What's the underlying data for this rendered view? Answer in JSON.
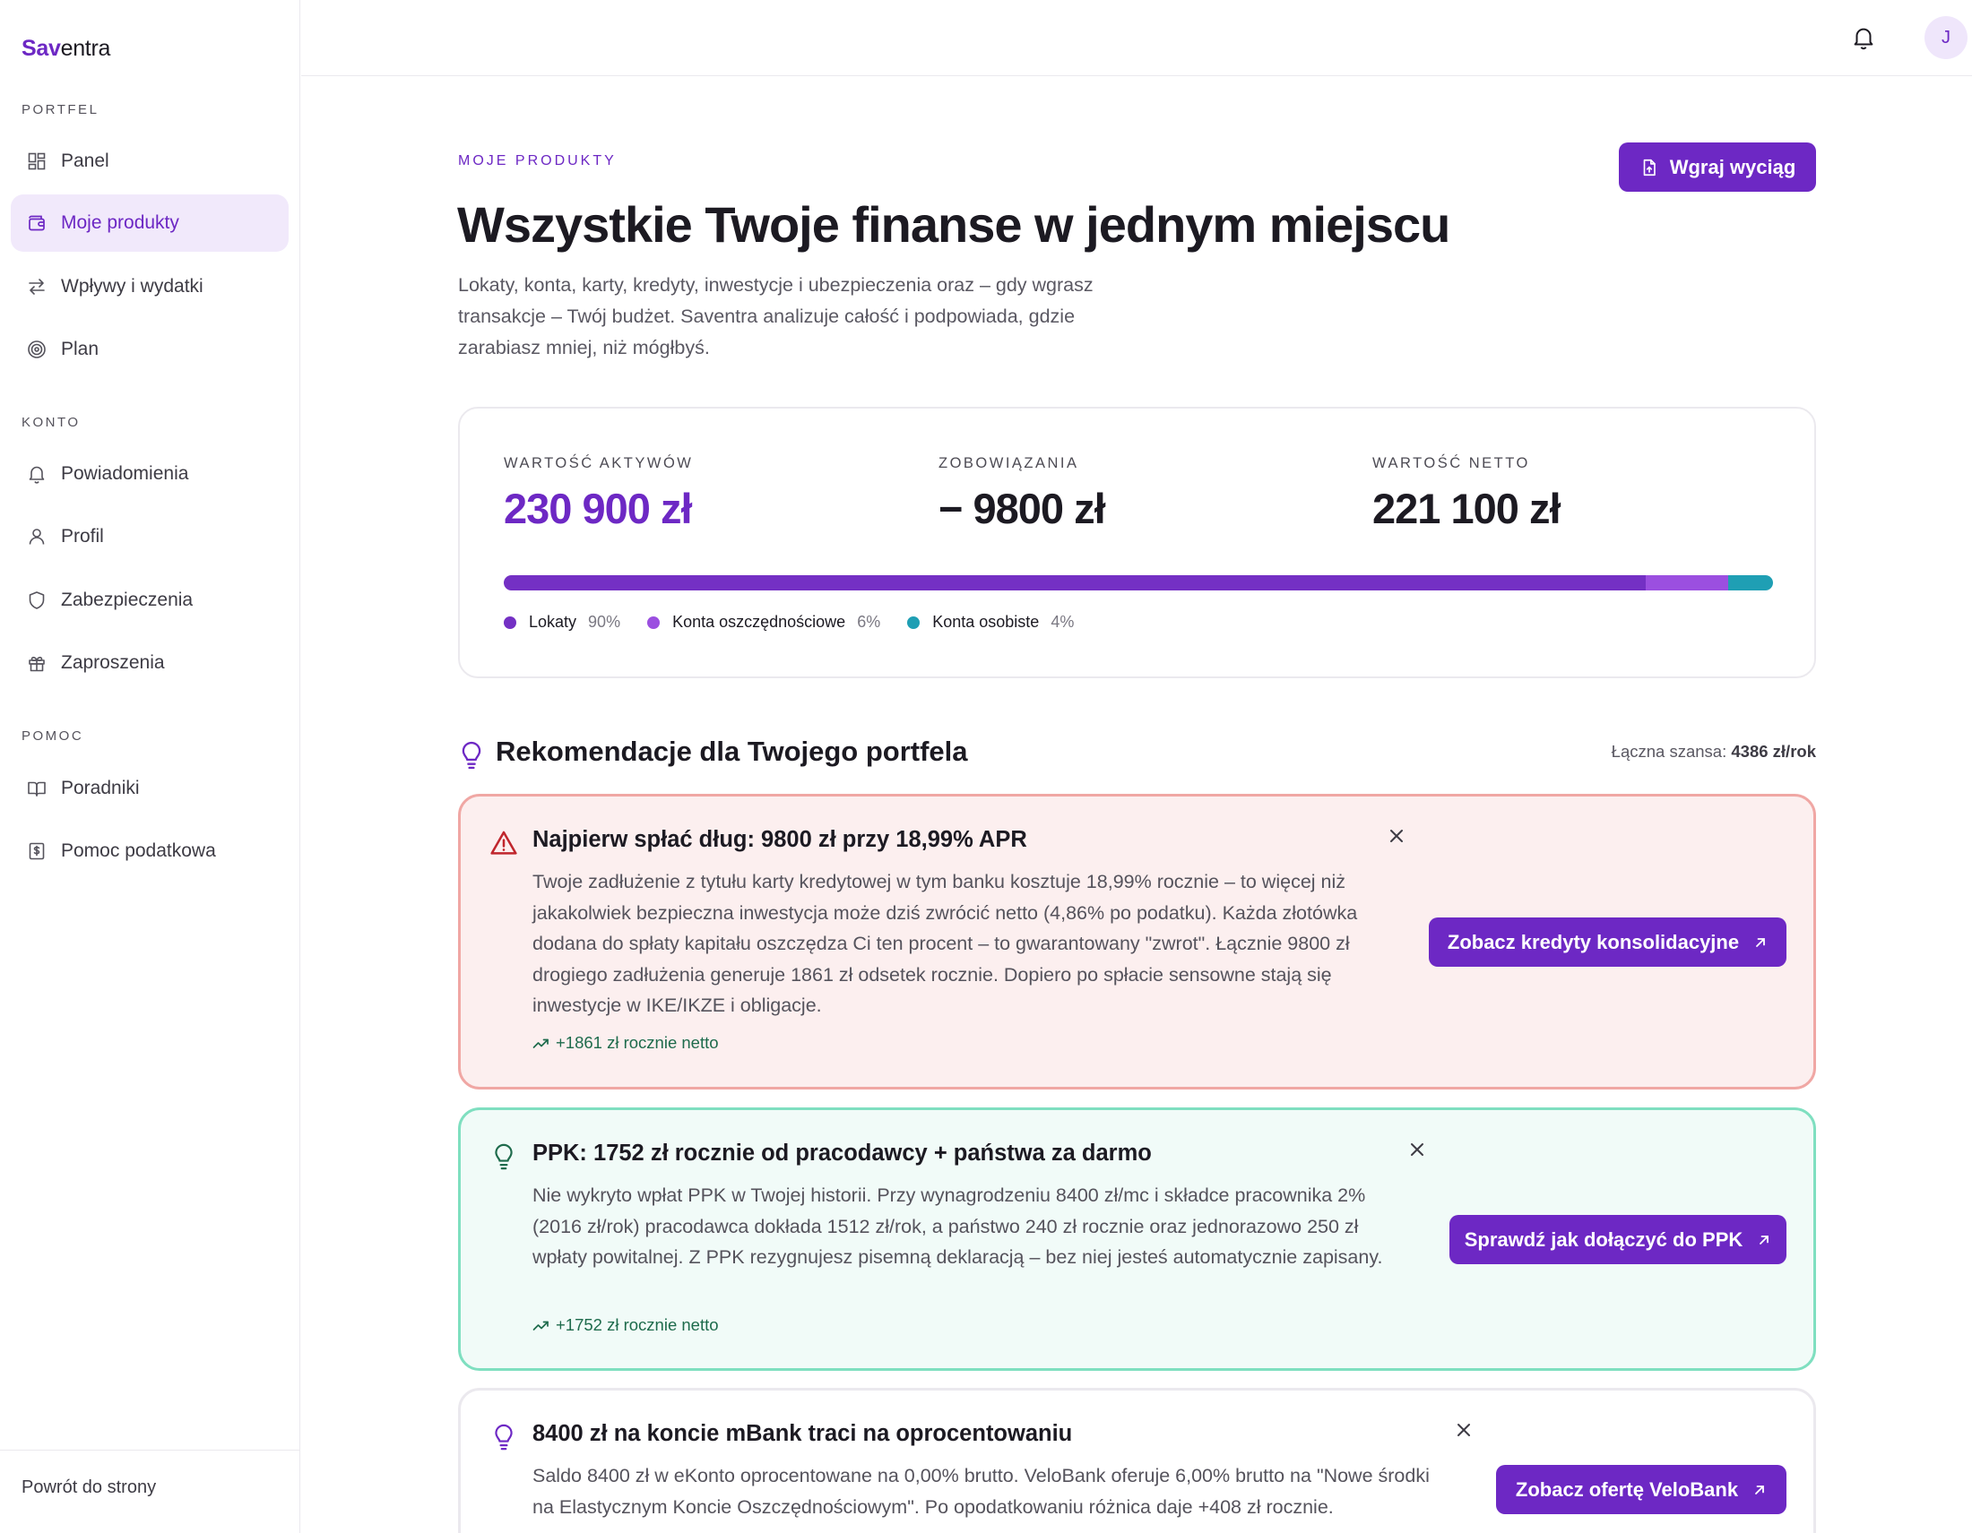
{
  "brand": {
    "part1": "Sav",
    "part2": "entra"
  },
  "sidebar": {
    "sections": [
      {
        "title": "PORTFEL"
      },
      {
        "title": "KONTO"
      },
      {
        "title": "POMOC"
      }
    ],
    "items": [
      {
        "label": "Panel",
        "icon": "dashboard-icon"
      },
      {
        "label": "Moje produkty",
        "icon": "wallet-icon",
        "active": true
      },
      {
        "label": "Wpływy i wydatki",
        "icon": "arrows-swap-icon"
      },
      {
        "label": "Plan",
        "icon": "target-icon"
      },
      {
        "label": "Powiadomienia",
        "icon": "bell-icon"
      },
      {
        "label": "Profil",
        "icon": "user-icon"
      },
      {
        "label": "Zabezpieczenia",
        "icon": "shield-icon"
      },
      {
        "label": "Zaproszenia",
        "icon": "gift-icon"
      },
      {
        "label": "Poradniki",
        "icon": "book-icon"
      },
      {
        "label": "Pomoc podatkowa",
        "icon": "tax-document-icon"
      }
    ],
    "back_link": "Powrót do strony"
  },
  "topbar": {
    "avatar_initial": "J"
  },
  "page": {
    "eyebrow": "MOJE PRODUKTY",
    "title": "Wszystkie Twoje finanse w jednym miejscu",
    "description": "Lokaty, konta, karty, kredyty, inwestycje i ubezpieczenia oraz – gdy wgrasz transakcje – Twój budżet. Saventra analizuje całość i podpowiada, gdzie zarabiasz mniej, niż mógłbyś.",
    "upload_button": "Wgraj wyciąg"
  },
  "summary": {
    "assets_label": "WARTOŚĆ AKTYWÓW",
    "assets_value": "230 900 zł",
    "liabilities_label": "ZOBOWIĄZANIA",
    "liabilities_value": "− 9800 zł",
    "net_label": "WARTOŚĆ NETTO",
    "net_value": "221 100 zł",
    "allocation": [
      {
        "name": "Lokaty",
        "percent_label": "90%",
        "share": 0.9,
        "color": "#7430c4"
      },
      {
        "name": "Konta oszczędnościowe",
        "percent_label": "6%",
        "share": 0.065,
        "color": "#9b4fe0"
      },
      {
        "name": "Konta osobiste",
        "percent_label": "4%",
        "share": 0.035,
        "color": "#1f9fb4"
      }
    ]
  },
  "recommendations": {
    "title": "Rekomendacje dla Twojego portfela",
    "total_prefix": "Łączna szansa:",
    "total_value": "4386 zł/rok",
    "items": [
      {
        "title": "Najpierw spłać dług: 9800 zł przy 18,99% APR",
        "body": "Twoje zadłużenie z tytułu karty kredytowej w tym banku kosztuje 18,99% rocznie – to więcej niż jakakolwiek bezpieczna inwestycja może dziś zwrócić netto (4,86% po podatku). Każda złotówka dodana do spłaty kapitału oszczędza Ci ten procent – to gwarantowany \"zwrot\". Łącznie 9800 zł drogiego zadłużenia generuje 1861 zł odsetek rocznie. Dopiero po spłacie sensowne stają się inwestycje w IKE/IKZE i obligacje.",
        "gain": "+1861 zł rocznie netto",
        "button": "Zobacz kredyty konsolidacyjne"
      },
      {
        "title": "PPK: 1752 zł rocznie od pracodawcy + państwa za darmo",
        "body": "Nie wykryto wpłat PPK w Twojej historii. Przy wynagrodzeniu 8400 zł/mc i składce pracownika 2% (2016 zł/rok) pracodawca dokłada 1512 zł/rok, a państwo 240 zł rocznie oraz jednorazowo 250 zł wpłaty powitalnej. Z PPK rezygnujesz pisemną deklaracją – bez niej jesteś automatycznie zapisany.",
        "gain": "+1752 zł rocznie netto",
        "button": "Sprawdź jak dołączyć do PPK"
      },
      {
        "title": "8400 zł na koncie mBank traci na oprocentowaniu",
        "body": "Saldo 8400 zł w eKonto oprocentowane na 0,00% brutto. VeloBank oferuje 6,00% brutto na \"Nowe środki na Elastycznym Koncie Oszczędnościowym\". Po opodatkowaniu różnica daje +408 zł rocznie.",
        "button": "Zobacz ofertę VeloBank"
      }
    ]
  },
  "colors": {
    "accent": "#6d28c4",
    "danger_bg": "#fcefef",
    "danger_border": "#f0a7a4",
    "success_bg": "#f1fbf8",
    "success_border": "#7fdfc0",
    "gain_text": "#1e6b4c"
  }
}
